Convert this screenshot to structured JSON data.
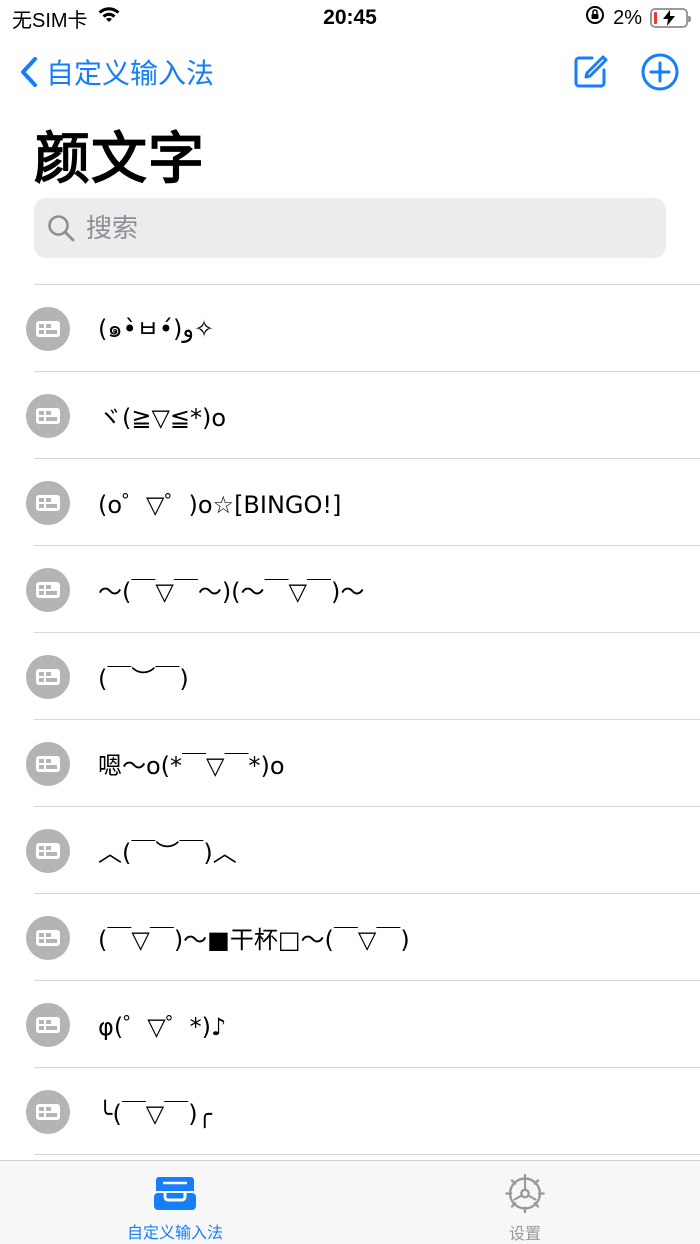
{
  "status_bar": {
    "carrier": "无SIM卡",
    "time": "20:45",
    "battery_percent": "2%",
    "battery_level": 0.02
  },
  "nav": {
    "back_label": "自定义输入法"
  },
  "title": "颜文字",
  "search": {
    "placeholder": "搜索"
  },
  "items": [
    "(๑•̀ㅂ•́)و✧",
    "ヾ(≧▽≦*)o",
    "(o゜▽゜)o☆[BINGO!]",
    "～(￣▽￣～)(～￣▽￣)～",
    "(￣︶￣)",
    "嗯～o(*￣▽￣*)o",
    "︿(￣︶￣)︿",
    "(￣▽￣)～■干杯□～(￣▽￣)",
    "φ(゜▽゜*)♪",
    "╰(￣▽￣)╭"
  ],
  "tabs": [
    {
      "label": "自定义输入法",
      "icon": "tray-icon",
      "active": true
    },
    {
      "label": "设置",
      "icon": "gear-icon",
      "active": false
    }
  ],
  "colors": {
    "accent": "#147EFB",
    "avatar": "#b4b4b6",
    "battery_low": "#e53935"
  }
}
